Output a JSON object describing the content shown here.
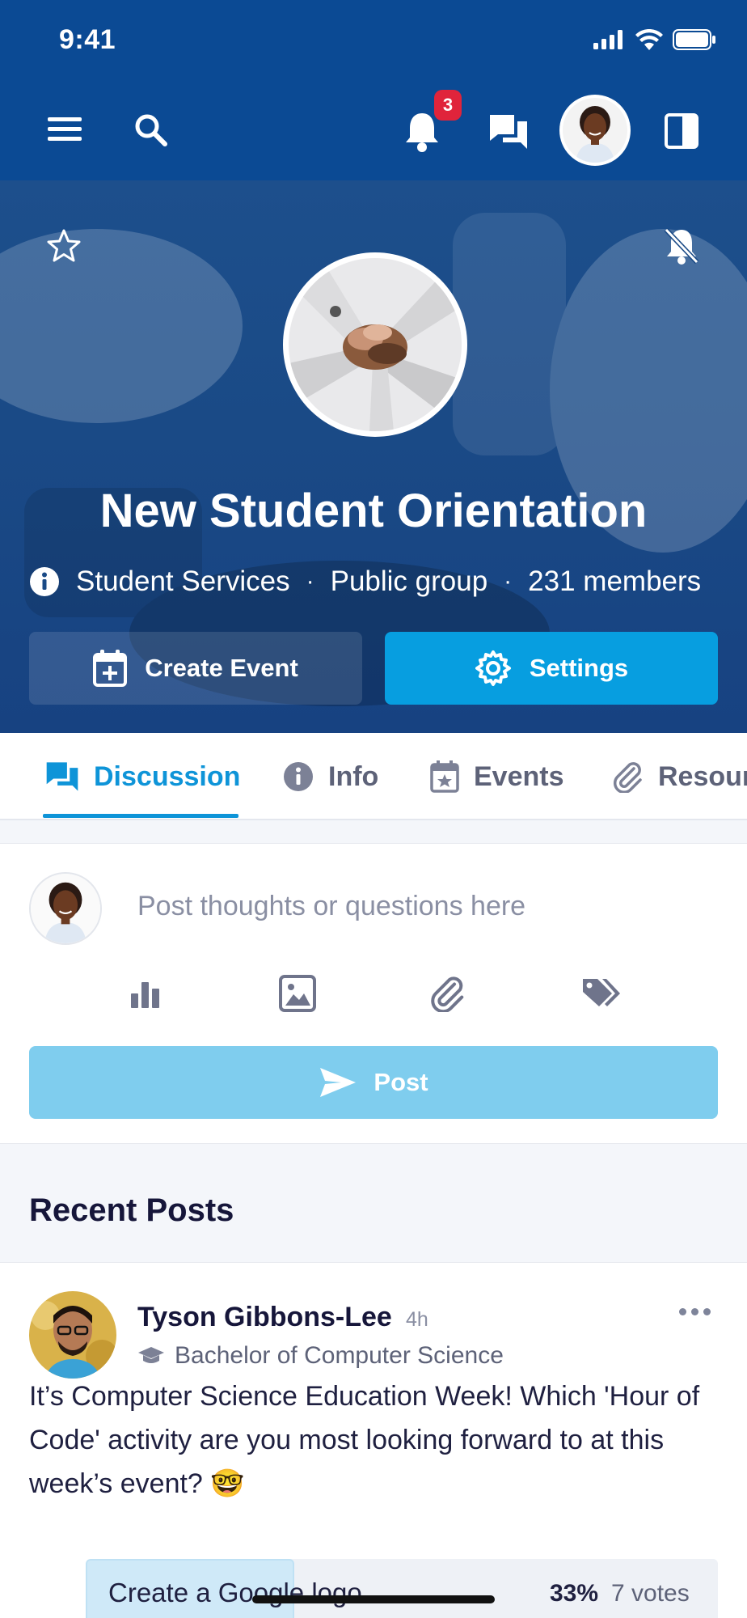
{
  "status_bar": {
    "time": "9:41"
  },
  "top_nav": {
    "notification_count": "3",
    "icons": [
      "menu-icon",
      "search-icon",
      "bell-icon",
      "chat-icon",
      "user-avatar",
      "sidebar-toggle-icon"
    ]
  },
  "group": {
    "title": "New Student Orientation",
    "category": "Student Services",
    "visibility": "Public group",
    "members": "231 members",
    "create_event_label": "Create Event",
    "settings_label": "Settings"
  },
  "tabs": [
    {
      "label": "Discussion",
      "icon": "chat-icon",
      "active": true
    },
    {
      "label": "Info",
      "icon": "info-icon",
      "active": false
    },
    {
      "label": "Events",
      "icon": "calendar-icon",
      "active": false
    },
    {
      "label": "Resour",
      "icon": "paperclip-icon",
      "active": false
    }
  ],
  "composer": {
    "placeholder": "Post thoughts or questions here",
    "tools": [
      "poll-icon",
      "image-icon",
      "attachment-icon",
      "tag-icon"
    ],
    "post_label": "Post"
  },
  "recent_posts": {
    "title": "Recent Posts",
    "post": {
      "author": "Tyson Gibbons-Lee",
      "time": "4h",
      "degree": "Bachelor of Computer Science",
      "body": "It’s Computer Science Education Week! Which 'Hour of Code' activity are you most looking forward to at this week’s event? 🤓",
      "poll": {
        "option": "Create a Google logo",
        "percent": "33%",
        "fill_fraction": 0.33,
        "votes": "7 votes"
      }
    }
  },
  "colors": {
    "brand_blue": "#0b4a94",
    "accent": "#079ee0",
    "badge": "#e0243b"
  }
}
